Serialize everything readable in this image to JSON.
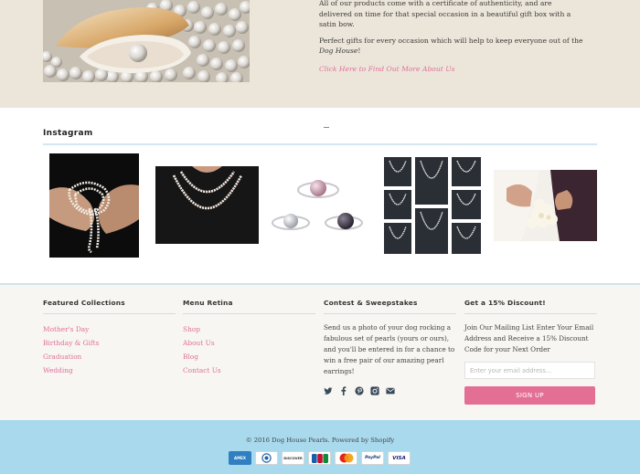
{
  "promo": {
    "line1": "All of our products come with a certificate of authenticity, and are delivered on time for that special occasion in a beautiful gift box with a satin bow.",
    "line2_start": "Perfect gifts for every occasion which will help to keep everyone out of the ",
    "line2_em": "Dog House",
    "line2_end": "!",
    "link": "Click Here to Find Out More About Us"
  },
  "instagram": {
    "title": "Instagram"
  },
  "footer": {
    "featured": {
      "heading": "Featured Collections",
      "items": [
        "Mother's Day",
        "Birthday & Gifts",
        "Graduation",
        "Wedding"
      ]
    },
    "menu": {
      "heading": "Menu Retina",
      "items": [
        "Shop",
        "About Us",
        "Blog",
        "Contact Us"
      ]
    },
    "contest": {
      "heading": "Contest & Sweepstakes",
      "text": "Send us a photo of your dog rocking a fabulous set of pearls (yours or ours), and you'll be entered in for a chance to win a free pair of our amazing pearl earrings!"
    },
    "discount": {
      "heading": "Get a 15% Discount!",
      "text": "Join Our Mailing List Enter Your Email Address and Receive a 15% Discount Code for your Next Order",
      "placeholder": "Enter your email address...",
      "button": "SIGN UP"
    }
  },
  "bottom": {
    "copyright": "© 2016 Dog House Pearls. Powered by Shopify",
    "cards": [
      "AMEX",
      "DINERS",
      "DISCOVER",
      "JCB",
      "MC",
      "PayPal",
      "VISA"
    ]
  },
  "colors": {
    "accent": "#e36f95",
    "link": "#e0709a",
    "bottom_bar": "#a8d9ed",
    "promo_bg": "#ece6da"
  }
}
